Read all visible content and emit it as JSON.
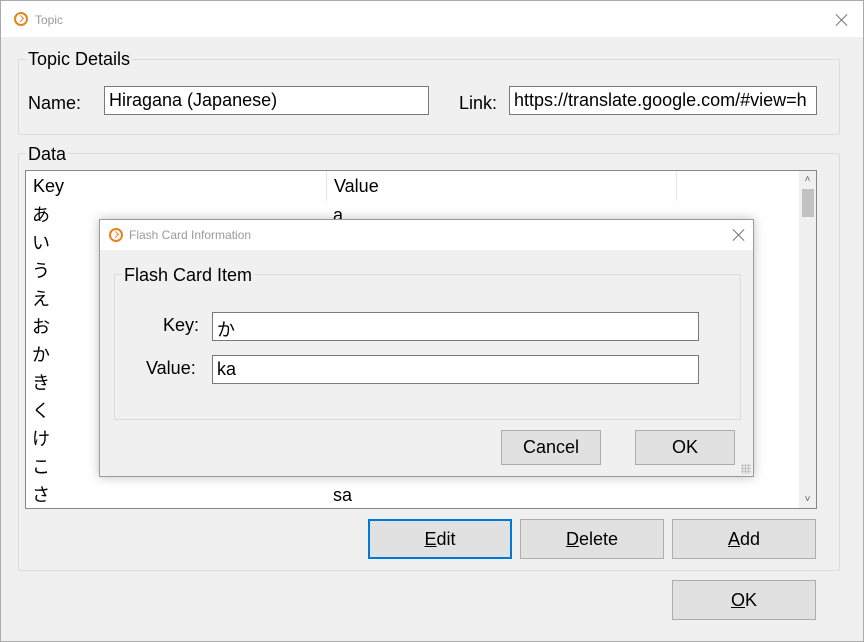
{
  "window": {
    "title": "Topic",
    "icon": "app-logo-icon",
    "close_icon": "close-icon"
  },
  "topic_details": {
    "group_title": "Topic Details",
    "name_label": "Name:",
    "name_value": "Hiragana (Japanese)",
    "link_label": "Link:",
    "link_value": "https://translate.google.com/#view=h"
  },
  "data_section": {
    "group_title": "Data",
    "columns": [
      "Key",
      "Value"
    ],
    "rows": [
      {
        "key": "あ",
        "value": "a"
      },
      {
        "key": "い",
        "value": ""
      },
      {
        "key": "う",
        "value": ""
      },
      {
        "key": "え",
        "value": ""
      },
      {
        "key": "お",
        "value": ""
      },
      {
        "key": "か",
        "value": ""
      },
      {
        "key": "き",
        "value": ""
      },
      {
        "key": "く",
        "value": ""
      },
      {
        "key": "け",
        "value": ""
      },
      {
        "key": "こ",
        "value": ""
      },
      {
        "key": "さ",
        "value": "sa"
      }
    ],
    "scroll_up": "˄",
    "scroll_down": "˅"
  },
  "actions": {
    "edit_mnemonic": "E",
    "edit_rest": "dit",
    "delete_mnemonic": "D",
    "delete_rest": "elete",
    "add_mnemonic": "A",
    "add_rest": "dd",
    "ok_mnemonic": "O",
    "ok_rest": "K"
  },
  "dialog": {
    "title": "Flash Card Information",
    "group_title": "Flash Card Item",
    "key_label": "Key:",
    "key_value": "か",
    "value_label": "Value:",
    "value_value": "ka",
    "cancel_label": "Cancel",
    "ok_label": "OK"
  },
  "colors": {
    "accent": "#0078d7",
    "icon_orange": "#e8821e"
  }
}
